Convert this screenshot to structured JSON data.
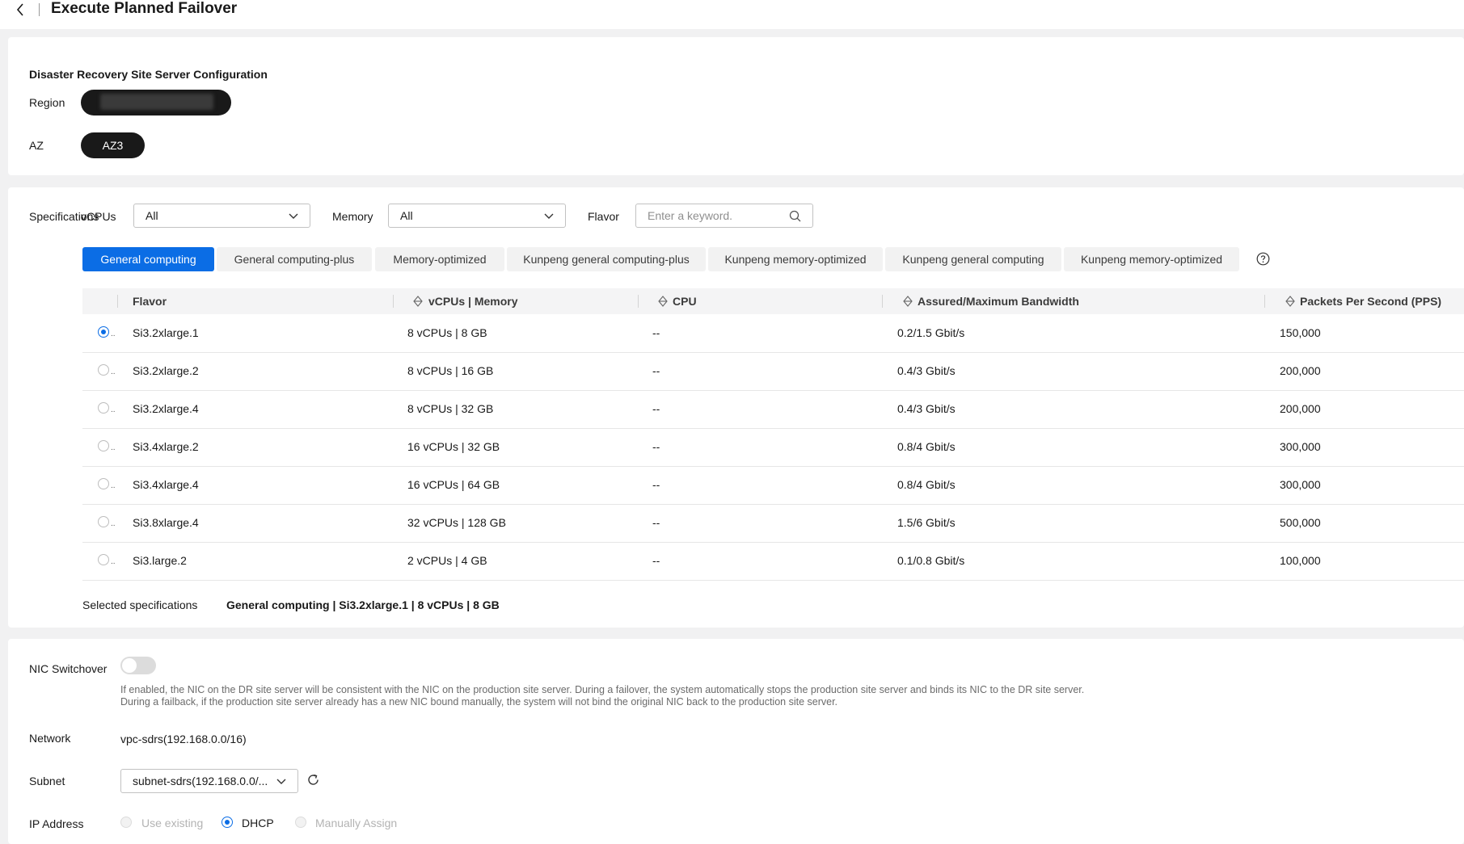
{
  "header": {
    "title": "Execute Planned Failover",
    "back_icon": "chevron-left-icon"
  },
  "dr_config": {
    "heading": "Disaster Recovery Site Server Configuration",
    "region_label": "Region",
    "region_value": "",
    "az_label": "AZ",
    "az_value": "AZ3"
  },
  "specifications": {
    "label": "Specifications",
    "vcpus_label": "vCPUs",
    "vcpus_value": "All",
    "memory_label": "Memory",
    "memory_value": "All",
    "flavor_label": "Flavor",
    "flavor_placeholder": "Enter a keyword.",
    "tabs": [
      "General computing",
      "General computing-plus",
      "Memory-optimized",
      "Kunpeng general computing-plus",
      "Kunpeng memory-optimized",
      "Kunpeng general computing",
      "Kunpeng memory-optimized"
    ],
    "columns": [
      "Flavor",
      "vCPUs | Memory",
      "CPU",
      "Assured/Maximum Bandwidth",
      "Packets Per Second (PPS)"
    ],
    "rows": [
      {
        "flavor": "Si3.2xlarge.1",
        "vcpus_memory": "8 vCPUs | 8 GB",
        "cpu": "--",
        "bandwidth": "0.2/1.5 Gbit/s",
        "pps": "150,000",
        "selected": true
      },
      {
        "flavor": "Si3.2xlarge.2",
        "vcpus_memory": "8 vCPUs | 16 GB",
        "cpu": "--",
        "bandwidth": "0.4/3 Gbit/s",
        "pps": "200,000",
        "selected": false
      },
      {
        "flavor": "Si3.2xlarge.4",
        "vcpus_memory": "8 vCPUs | 32 GB",
        "cpu": "--",
        "bandwidth": "0.4/3 Gbit/s",
        "pps": "200,000",
        "selected": false
      },
      {
        "flavor": "Si3.4xlarge.2",
        "vcpus_memory": "16 vCPUs | 32 GB",
        "cpu": "--",
        "bandwidth": "0.8/4 Gbit/s",
        "pps": "300,000",
        "selected": false
      },
      {
        "flavor": "Si3.4xlarge.4",
        "vcpus_memory": "16 vCPUs | 64 GB",
        "cpu": "--",
        "bandwidth": "0.8/4 Gbit/s",
        "pps": "300,000",
        "selected": false
      },
      {
        "flavor": "Si3.8xlarge.4",
        "vcpus_memory": "32 vCPUs | 128 GB",
        "cpu": "--",
        "bandwidth": "1.5/6 Gbit/s",
        "pps": "500,000",
        "selected": false
      },
      {
        "flavor": "Si3.large.2",
        "vcpus_memory": "2 vCPUs | 4 GB",
        "cpu": "--",
        "bandwidth": "0.1/0.8 Gbit/s",
        "pps": "100,000",
        "selected": false
      }
    ],
    "selected_label": "Selected specifications",
    "selected_value": "General computing | Si3.2xlarge.1 | 8 vCPUs | 8 GB"
  },
  "network_config": {
    "nic_switchover_label": "NIC Switchover",
    "nic_switchover_on": false,
    "nic_desc_line1": "If enabled, the NIC on the DR site server will be consistent with the NIC on the production site server. During a failover, the system automatically stops the production site server and binds its NIC to the DR site server.",
    "nic_desc_line2": "During a failback, if the production site server already has a new NIC bound manually, the system will not bind the original NIC back to the production site server.",
    "network_label": "Network",
    "network_value": "vpc-sdrs(192.168.0.0/16)",
    "subnet_label": "Subnet",
    "subnet_value": "subnet-sdrs(192.168.0.0/...",
    "ip_label": "IP Address",
    "ip_options": [
      "Use existing",
      "DHCP",
      "Manually Assign"
    ],
    "ip_selected": "DHCP"
  },
  "colors": {
    "accent": "#0b6de5",
    "pill": "#191919"
  }
}
